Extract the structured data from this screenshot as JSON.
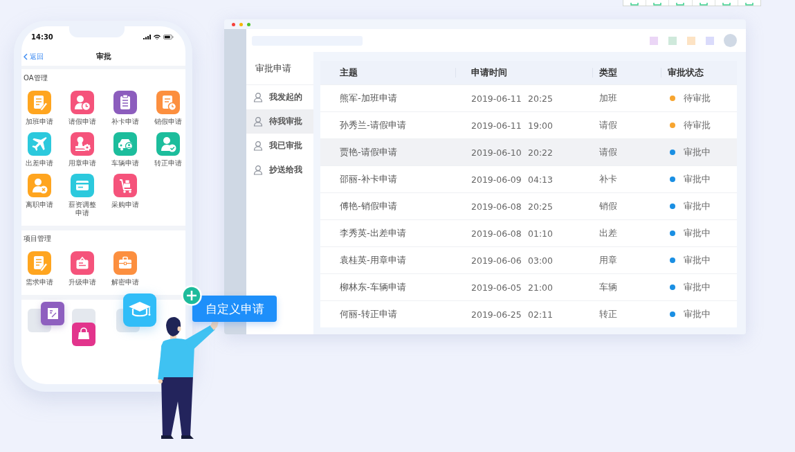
{
  "phone": {
    "status_time": "14:30",
    "back_label": "返回",
    "title": "审批",
    "sections": [
      {
        "title": "OA管理",
        "apps": [
          {
            "label": "加班申请",
            "color": "#ffa51f"
          },
          {
            "label": "请假申请",
            "color": "#f5537b"
          },
          {
            "label": "补卡申请",
            "color": "#8c5dbd"
          },
          {
            "label": "销假申请",
            "color": "#fc8f3f"
          },
          {
            "label": "出差申请",
            "color": "#2cc9dd"
          },
          {
            "label": "用章申请",
            "color": "#f5537b"
          },
          {
            "label": "车辆申请",
            "color": "#1cbd9c"
          },
          {
            "label": "转正申请",
            "color": "#1cbd9c"
          },
          {
            "label": "离职申请",
            "color": "#ffa51f"
          },
          {
            "label": "薪资调整申请",
            "color": "#2cc9dd"
          },
          {
            "label": "采购申请",
            "color": "#f5537b"
          }
        ]
      },
      {
        "title": "项目管理",
        "apps": [
          {
            "label": "需求申请",
            "color": "#ffa51f"
          },
          {
            "label": "升级申请",
            "color": "#f5537b"
          },
          {
            "label": "解密申请",
            "color": "#fc8f3f"
          }
        ]
      }
    ]
  },
  "custom_button": {
    "label": "自定义申请"
  },
  "window": {
    "header": {
      "swatches": [
        {
          "color": "#ebd6f6"
        },
        {
          "color": "#cfe9db"
        },
        {
          "color": "#fde3c4"
        },
        {
          "color": "#dadbfb"
        }
      ]
    },
    "sidebar": {
      "title": "审批申请",
      "items": [
        {
          "label": "我发起的",
          "selected": false
        },
        {
          "label": "待我审批",
          "selected": true
        },
        {
          "label": "我已审批",
          "selected": false
        },
        {
          "label": "抄送给我",
          "selected": false
        }
      ]
    },
    "table": {
      "columns": [
        "主题",
        "申请时间",
        "类型",
        "审批状态"
      ],
      "rows": [
        {
          "subject": "熊军-加班申请",
          "date": "2019-06-11",
          "time": "20:25",
          "type": "加班",
          "status": "待审批",
          "color": "#f7a52f",
          "selected": false
        },
        {
          "subject": "孙秀兰-请假申请",
          "date": "2019-06-11",
          "time": "19:00",
          "type": "请假",
          "status": "待审批",
          "color": "#f7a52f",
          "selected": false
        },
        {
          "subject": "贾艳-请假申请",
          "date": "2019-06-10",
          "time": "20:22",
          "type": "请假",
          "status": "审批中",
          "color": "#1a8fe3",
          "selected": true
        },
        {
          "subject": "邵丽-补卡申请",
          "date": "2019-06-09",
          "time": "04:13",
          "type": "补卡",
          "status": "审批中",
          "color": "#1a8fe3",
          "selected": false
        },
        {
          "subject": "傅艳-销假申请",
          "date": "2019-06-08",
          "time": "20:25",
          "type": "销假",
          "status": "审批中",
          "color": "#1a8fe3",
          "selected": false
        },
        {
          "subject": "李秀英-出差申请",
          "date": "2019-06-08",
          "time": "01:10",
          "type": "出差",
          "status": "审批中",
          "color": "#1a8fe3",
          "selected": false
        },
        {
          "subject": "袁桂英-用章申请",
          "date": "2019-06-06",
          "time": "03:00",
          "type": "用章",
          "status": "审批中",
          "color": "#1a8fe3",
          "selected": false
        },
        {
          "subject": "柳林东-车辆申请",
          "date": "2019-06-05",
          "time": "21:00",
          "type": "车辆",
          "status": "审批中",
          "color": "#1a8fe3",
          "selected": false
        },
        {
          "subject": "何丽-转正申请",
          "date": "2019-06-25",
          "time": "02:11",
          "type": "转正",
          "status": "审批中",
          "color": "#1a8fe3",
          "selected": false
        }
      ]
    }
  }
}
